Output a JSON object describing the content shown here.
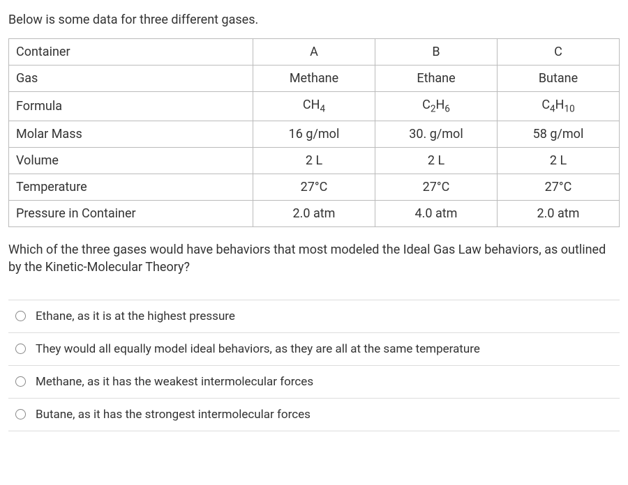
{
  "intro_text": "Below is some data for three different gases.",
  "table": {
    "rows": [
      {
        "label": "Container",
        "a": "A",
        "b": "B",
        "c": "C"
      },
      {
        "label": "Gas",
        "a": "Methane",
        "b": "Ethane",
        "c": "Butane"
      },
      {
        "label": "Formula",
        "a_html": "CH<sub>4</sub>",
        "b_html": "C<sub>2</sub>H<sub>6</sub>",
        "c_html": "C<sub>4</sub>H<sub>10</sub>"
      },
      {
        "label": "Molar Mass",
        "a": "16 g/mol",
        "b": "30. g/mol",
        "c": "58 g/mol"
      },
      {
        "label": "Volume",
        "a": "2 L",
        "b": "2 L",
        "c": "2 L"
      },
      {
        "label": "Temperature",
        "a": "27°C",
        "b": "27°C",
        "c": "27°C"
      },
      {
        "label": "Pressure in Container",
        "a": "2.0 atm",
        "b": "4.0 atm",
        "c": "2.0 atm"
      }
    ]
  },
  "question_text": "Which of the three gases would have behaviors that most modeled the Ideal Gas Law behaviors, as outlined by the Kinetic-Molecular Theory?",
  "options": [
    "Ethane, as it is at the highest pressure",
    "They would all equally model ideal behaviors, as they are all at the same temperature",
    "Methane, as it has the weakest intermolecular forces",
    "Butane, as it has the strongest intermolecular forces"
  ]
}
